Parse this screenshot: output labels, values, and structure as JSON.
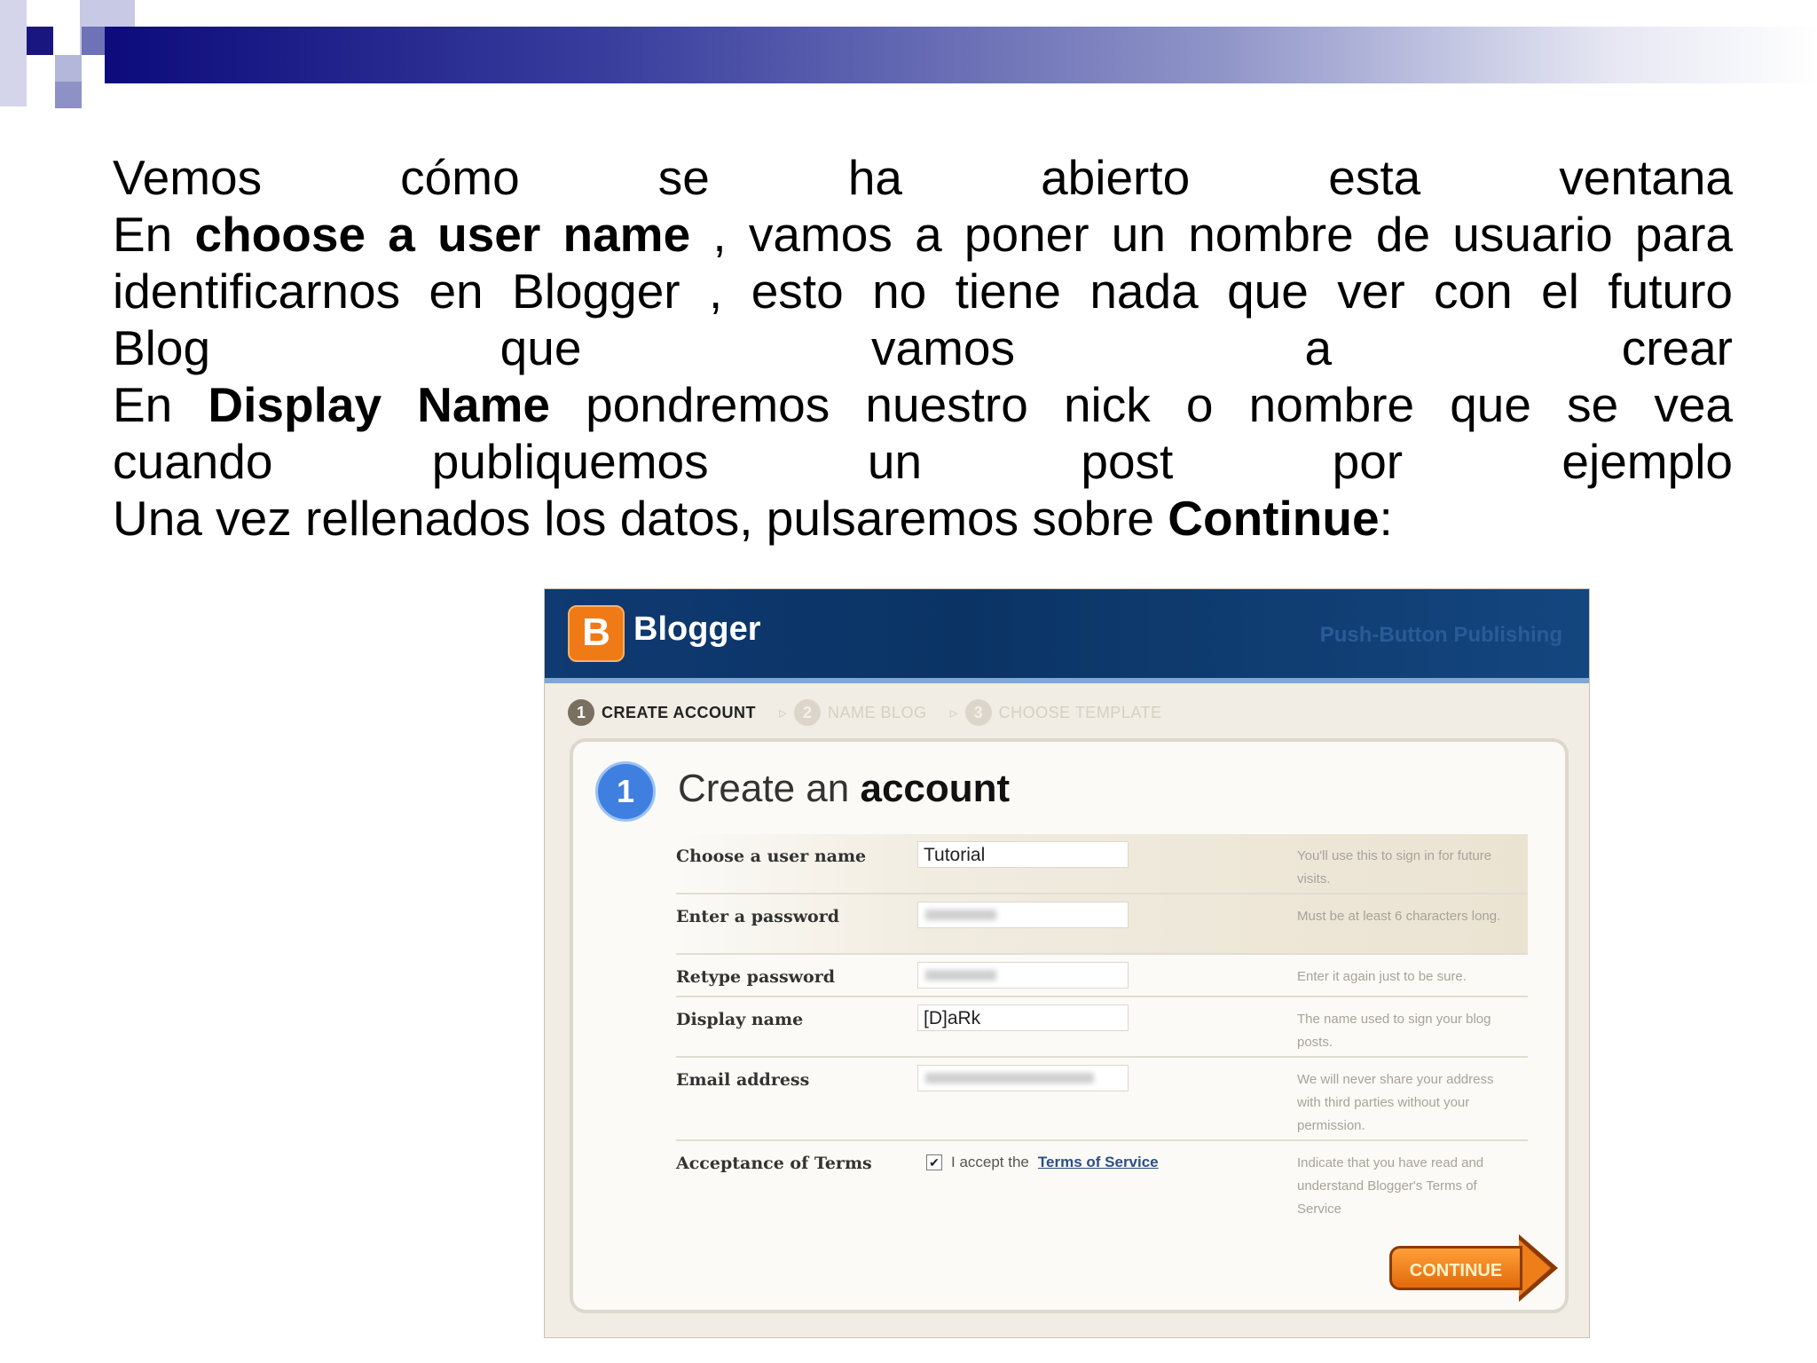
{
  "slide": {
    "lines": [
      {
        "segments": [
          "Vemos cómo se ha abierto esta ventana"
        ]
      },
      {
        "pre": "En ",
        "bold": "choose a user name",
        "post": " , vamos a poner un nombre de usuario para"
      },
      {
        "text": "identificarnos en Blogger , esto no tiene nada que ver con el futuro"
      },
      {
        "text": "Blog que vamos a crear"
      },
      {
        "pre": "En ",
        "bold": "Display Name",
        "post": " pondremos nuestro nick o nombre que se vea"
      },
      {
        "text": "cuando publiquemos un post por ejemplo"
      },
      {
        "pre": "Una vez rellenados los datos, pulsaremos sobre ",
        "bold": "Continue",
        "post": ":"
      }
    ]
  },
  "blogger": {
    "logo_letter": "B",
    "brand": "Blogger",
    "tagline": "Push-Button Publishing",
    "steps": [
      {
        "num": "1",
        "label": "CREATE ACCOUNT"
      },
      {
        "num": "2",
        "label": "NAME BLOG"
      },
      {
        "num": "3",
        "label": "CHOOSE TEMPLATE"
      }
    ],
    "panel_num": "1",
    "panel_title_pre": "Create an ",
    "panel_title_bold": "account",
    "form": {
      "username": {
        "label": "Choose a user name",
        "value": "Tutorial",
        "help": "You'll use this to sign in for future visits."
      },
      "password": {
        "label": "Enter a password",
        "help": "Must be at least 6 characters long."
      },
      "retype": {
        "label": "Retype password",
        "help": "Enter it again just to be sure."
      },
      "display": {
        "label": "Display name",
        "value": "[D]aRk",
        "help": "The name used to sign your blog posts."
      },
      "email": {
        "label": "Email address",
        "help": "We will never share your address with third parties without your permission."
      },
      "terms": {
        "label": "Acceptance of Terms",
        "check_mark": "✔",
        "accept_text": "I accept the",
        "link_text": "Terms of Service",
        "help": "Indicate that you have read and understand Blogger's Terms of Service"
      }
    },
    "continue_label": "CONTINUE"
  }
}
